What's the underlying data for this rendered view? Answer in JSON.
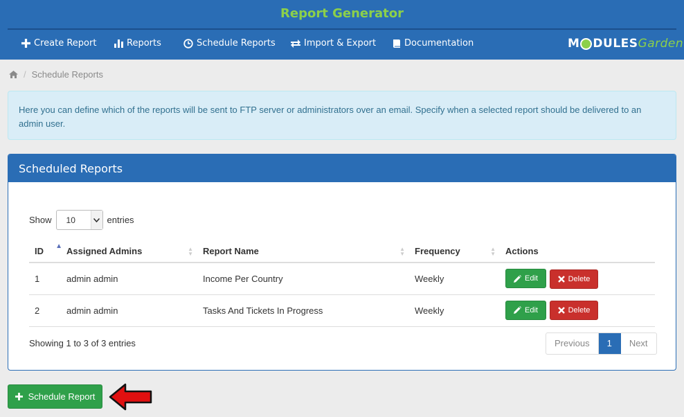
{
  "app": {
    "title": "Report Generator"
  },
  "nav": {
    "items": [
      {
        "label": "Create Report",
        "icon": "plus-icon"
      },
      {
        "label": "Reports",
        "icon": "bar-chart-icon"
      },
      {
        "label": "Schedule Reports",
        "icon": "clock-icon"
      },
      {
        "label": "Import & Export",
        "icon": "exchange-icon"
      },
      {
        "label": "Documentation",
        "icon": "book-icon"
      }
    ]
  },
  "logo": {
    "m": "M",
    "odules": "DULES",
    "garden": "Garden"
  },
  "breadcrumb": {
    "home_icon": "home-icon",
    "current": "Schedule Reports"
  },
  "info": {
    "text": "Here you can define which of the reports will be sent to FTP server or administrators over an email. Specify when a selected report should be delivered to an admin user."
  },
  "panel": {
    "title": "Scheduled Reports",
    "show_label": "Show",
    "entries_label": "entries",
    "page_size": "10",
    "columns": [
      "ID",
      "Assigned Admins",
      "Report Name",
      "Frequency",
      "Actions"
    ],
    "rows": [
      {
        "id": "1",
        "admins": "admin admin",
        "report": "Income Per Country",
        "frequency": "Weekly"
      },
      {
        "id": "2",
        "admins": "admin admin",
        "report": "Tasks And Tickets In Progress",
        "frequency": "Weekly"
      }
    ],
    "edit_label": "Edit",
    "delete_label": "Delete",
    "showing_text": "Showing 1 to 3 of 3 entries",
    "pagination": {
      "previous": "Previous",
      "current": "1",
      "next": "Next"
    }
  },
  "schedule_button": {
    "label": "Schedule Report"
  },
  "colors": {
    "primary": "#2a6db5",
    "success": "#2fa04a",
    "danger": "#c9302c",
    "accent": "#8cd04a",
    "arrow": "#e01010"
  }
}
